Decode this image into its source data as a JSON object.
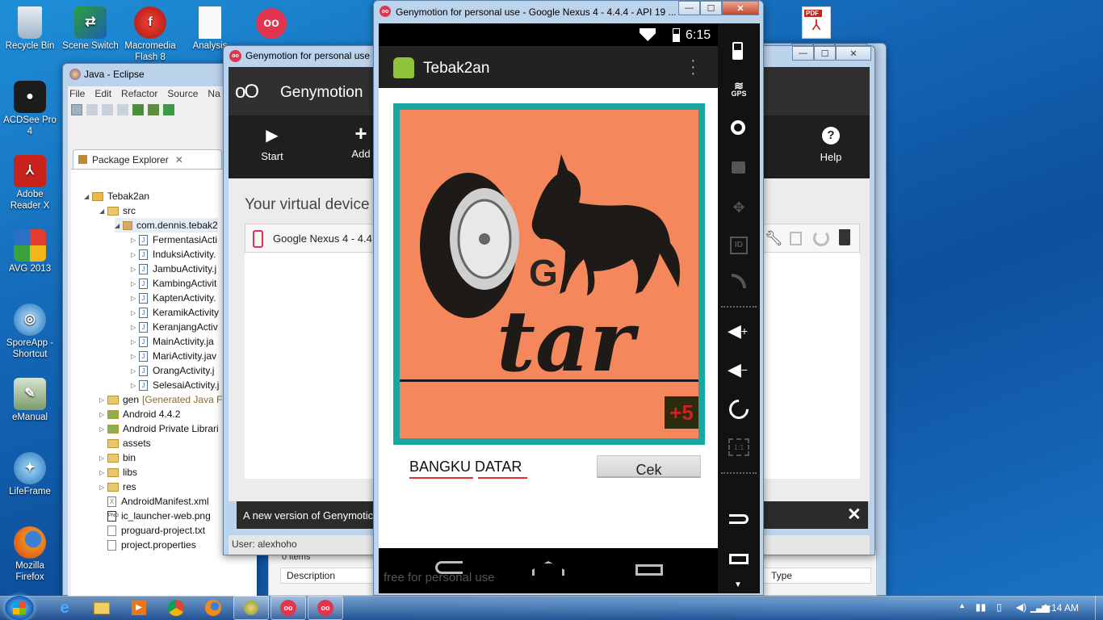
{
  "desktop": {
    "icons": [
      {
        "label": "Recycle Bin",
        "icon": "recycle-bin-icon"
      },
      {
        "label": "Scene Switch",
        "icon": "scene-switch-icon"
      },
      {
        "label": "Macromedia Flash 8",
        "icon": "flash-icon"
      },
      {
        "label": "Analysis",
        "icon": "document-icon"
      },
      {
        "label": "ACDSee Pro 4",
        "icon": "camera-icon"
      },
      {
        "label": "Adobe Reader X",
        "icon": "adobe-reader-icon"
      },
      {
        "label": "AVG 2013",
        "icon": "avg-icon"
      },
      {
        "label": "SporeApp - Shortcut",
        "icon": "spore-icon"
      },
      {
        "label": "eManual",
        "icon": "emanual-icon"
      },
      {
        "label": "LifeFrame",
        "icon": "lifeframe-icon"
      },
      {
        "label": "Mozilla Firefox",
        "icon": "firefox-icon"
      }
    ]
  },
  "eclipse": {
    "title": "Java - Eclipse",
    "menu": [
      "File",
      "Edit",
      "Refactor",
      "Source",
      "Na"
    ],
    "package_explorer": {
      "tab": "Package Explorer",
      "project": "Tebak2an",
      "src": "src",
      "package": "com.dennis.tebak2",
      "files": [
        "FermentasiActi",
        "InduksiActivity.",
        "JambuActivity.j",
        "KambingActivit",
        "KaptenActivity.",
        "KeramikActivity",
        "KeranjangActiv",
        "MainActivity.ja",
        "MariActivity.jav",
        "OrangActivity.j",
        "SelesaiActivity.j"
      ],
      "gen_label": "gen",
      "gen_note": "[Generated Java Fi",
      "others": [
        "Android 4.4.2",
        "Android Private Librari",
        "assets",
        "bin",
        "libs",
        "res"
      ],
      "root_files": [
        "AndroidManifest.xml",
        "ic_launcher-web.png",
        "proguard-project.txt",
        "project.properties"
      ]
    },
    "problems": {
      "count": "0 items",
      "col_description": "Description",
      "col_type": "Type"
    }
  },
  "genymotion": {
    "window_title": "Genymotion for personal use",
    "brand": "Genymotion",
    "toolbar": {
      "start": "Start",
      "add": "Add",
      "help": "Help"
    },
    "section_title": "Your virtual device",
    "device": "Google Nexus 4 - 4.4.",
    "banner": "A new version of Genymotic",
    "user": "User: alexhoho"
  },
  "emulator": {
    "window_title": "Genymotion for personal use - Google Nexus 4 - 4.4.4 - API 19 ...",
    "status_time": "6:15",
    "app_title": "Tebak2an",
    "puzzle": {
      "letter": "G",
      "word": "tar",
      "badge": "+5"
    },
    "answer_value": "BANGKU DATAR",
    "check_button": "Cek",
    "watermark": "free for personal use",
    "side_buttons": [
      "battery-icon",
      "gps-icon",
      "camera-icon",
      "video-icon",
      "dpad-icon",
      "id-icon",
      "rss-icon",
      "volume-up-icon",
      "volume-down-icon",
      "rotate-icon",
      "scale-icon",
      "back-icon",
      "recent-apps-icon",
      "menu-down-icon"
    ],
    "gps_label": "GPS",
    "id_label": "ID",
    "scale_label": "1:1"
  },
  "taskbar": {
    "clock": "1:14 AM"
  }
}
